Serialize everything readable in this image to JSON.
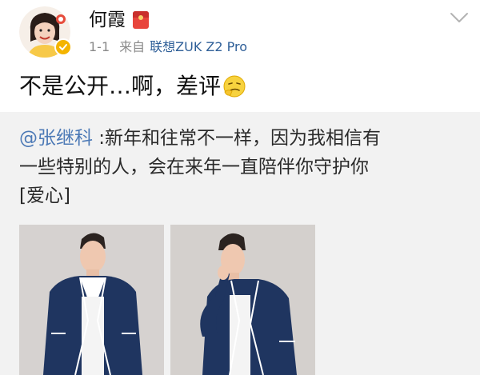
{
  "author": {
    "name": "何霞",
    "date": "1-1",
    "from_label": "来自",
    "device": "联想ZUK Z2 Pro"
  },
  "post": {
    "text": "不是公开…啊，差评",
    "emoji": "smirk-emoji"
  },
  "repost": {
    "mention": "@张继科",
    "line1_rest": " :新年和往常不一样，因为我相信有",
    "line2": "一些特别的人，会在来年一直陪伴你守护你",
    "line3": "[爱心]"
  },
  "icons": {
    "expand": "chevron-down-icon",
    "badge": "red-packet-icon",
    "verified": "verified-badge-icon"
  },
  "colors": {
    "link_blue": "#4d7ab6",
    "device_blue": "#2f5f98",
    "meta_gray": "#8a8a8a",
    "repost_bg": "#f2f2f2",
    "verified_gold": "#f4b400",
    "jacket_navy": "#1f3560"
  }
}
